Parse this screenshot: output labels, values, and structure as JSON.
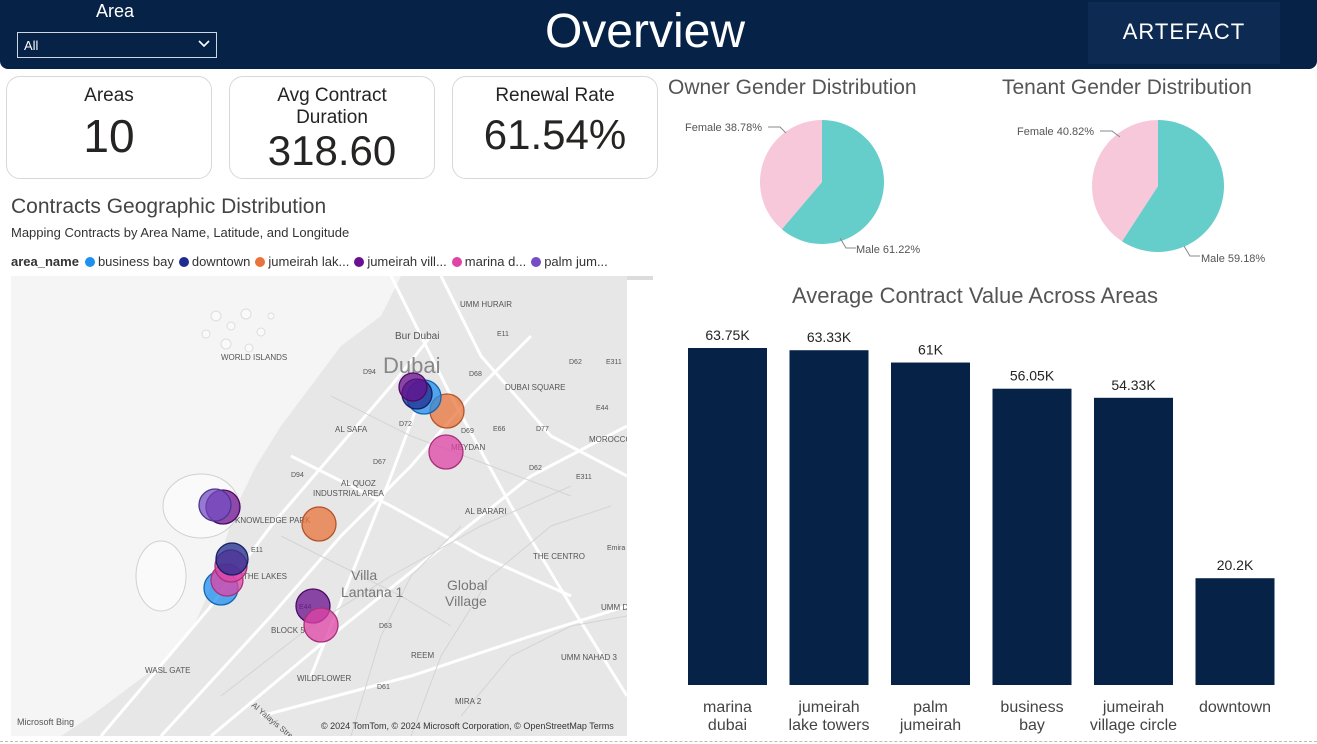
{
  "header": {
    "filter_label": "Area",
    "filter_value": "All",
    "title": "Overview",
    "logo_text": "ARTEFACT"
  },
  "cards": [
    {
      "label": "Areas",
      "value": "10"
    },
    {
      "label": "Avg Contract Duration",
      "value": "318.60"
    },
    {
      "label": "Renewal Rate",
      "value": "61.54%"
    }
  ],
  "map": {
    "title": "Contracts Geographic Distribution",
    "subtitle": "Mapping Contracts by Area Name, Latitude, and Longitude",
    "legend_label": "area_name",
    "legend_items": [
      {
        "name": "business bay",
        "color": "#1f8ff0"
      },
      {
        "name": "downtown",
        "color": "#1f2d8f"
      },
      {
        "name": "jumeirah lak...",
        "color": "#e8743b"
      },
      {
        "name": "jumeirah vill...",
        "color": "#6a0f8e"
      },
      {
        "name": "marina d...",
        "color": "#e044a7"
      },
      {
        "name": "palm jum...",
        "color": "#744ec2"
      }
    ],
    "place_labels": [
      "UMM HURAIR",
      "WORLD ISLANDS",
      "Bur Dubai",
      "Dubai",
      "DUBAI SQUARE",
      "AL SAFA",
      "MEYDAN",
      "MOROCCO",
      "AL QUOZ INDUSTRIAL AREA",
      "AL BARARI",
      "KNOWLEDGE PARK",
      "THE CENTRO",
      "THE LAKES",
      "Villa Lantana 1",
      "Global Village",
      "UMM DA",
      "BLOCK 5",
      "WASL GATE",
      "REEM",
      "UMM NAHAD 3",
      "WILDFLOWER",
      "MIRA 2",
      "Al Yalayis Street",
      "E11",
      "D94",
      "D72",
      "D68",
      "D62",
      "E311",
      "E44",
      "E66",
      "D77",
      "D69",
      "D67",
      "D63",
      "D61",
      "Emira"
    ],
    "bing_label": "Microsoft Bing",
    "credit": "© 2024 TomTom, © 2024 Microsoft Corporation, © OpenStreetMap Terms"
  },
  "owner_pie": {
    "title": "Owner Gender Distribution",
    "female_label": "Female 38.78%",
    "male_label": "Male 61.22%",
    "female_pct": 38.78,
    "male_pct": 61.22,
    "female_color": "#f7c8da",
    "male_color": "#65cdca"
  },
  "tenant_pie": {
    "title": "Tenant Gender Distribution",
    "female_label": "Female 40.82%",
    "male_label": "Male 59.18%",
    "female_pct": 40.82,
    "male_pct": 59.18,
    "female_color": "#f7c8da",
    "male_color": "#65cdca"
  },
  "chart_data": {
    "type": "bar",
    "title": "Average Contract Value Across Areas",
    "categories": [
      "marina dubai",
      "jumeirah lake towers",
      "palm jumeirah",
      "business bay",
      "jumeirah village circle",
      "downtown"
    ],
    "category_lines": [
      [
        "marina",
        "dubai"
      ],
      [
        "jumeirah",
        "lake towers"
      ],
      [
        "palm",
        "jumeirah"
      ],
      [
        "business",
        "bay"
      ],
      [
        "jumeirah",
        "village circle"
      ],
      [
        "downtown"
      ]
    ],
    "values": [
      63750,
      63330,
      61000,
      56050,
      54330,
      20200
    ],
    "data_labels": [
      "63.75K",
      "63.33K",
      "61K",
      "56.05K",
      "54.33K",
      "20.2K"
    ],
    "bar_color": "#062247",
    "ylim": [
      0,
      63750
    ],
    "grid": false,
    "xlabel": "",
    "ylabel": ""
  }
}
